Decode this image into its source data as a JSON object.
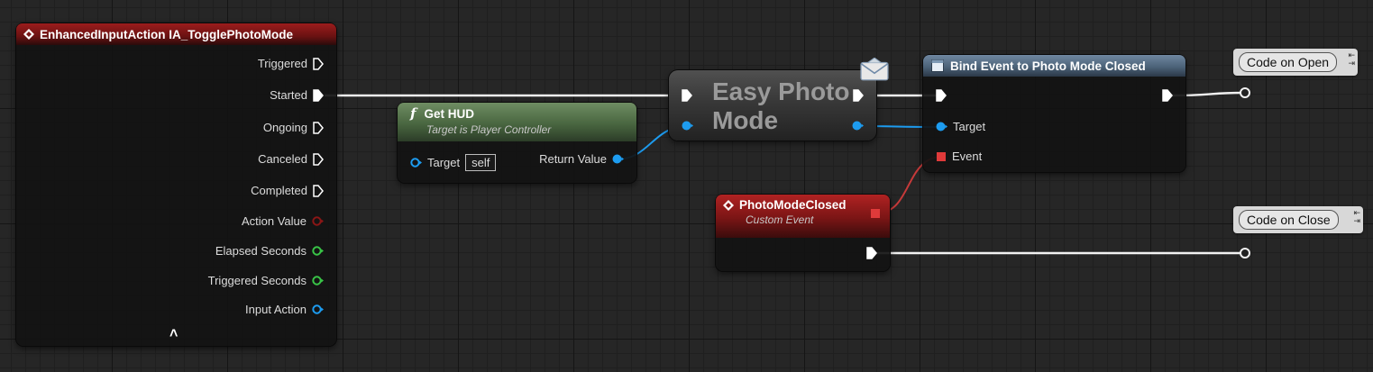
{
  "input_node": {
    "title": "EnhancedInputAction IA_TogglePhotoMode",
    "pins": [
      "Triggered",
      "Started",
      "Ongoing",
      "Canceled",
      "Completed",
      "Action Value",
      "Elapsed Seconds",
      "Triggered Seconds",
      "Input Action"
    ],
    "collapse_glyph": "˄"
  },
  "get_hud": {
    "func_glyph": "f",
    "title": "Get HUD",
    "subtitle": "Target is Player Controller",
    "target_label": "Target",
    "target_value": "self",
    "return_label": "Return Value"
  },
  "easy_photo": {
    "title_line1": "Easy Photo",
    "title_line2": "Mode"
  },
  "bind_event": {
    "title": "Bind Event to Photo Mode Closed",
    "target_label": "Target",
    "event_label": "Event"
  },
  "custom_event": {
    "title": "PhotoModeClosed",
    "subtitle": "Custom Event"
  },
  "comments": {
    "open": "Code on Open",
    "close": "Code on Close"
  },
  "colors": {
    "exec": "#ffffff",
    "object_pin": "#1d9cf0",
    "delegate_pin": "#e03a3a",
    "float_pin": "#39c447",
    "struct_pin": "#8a1616"
  }
}
